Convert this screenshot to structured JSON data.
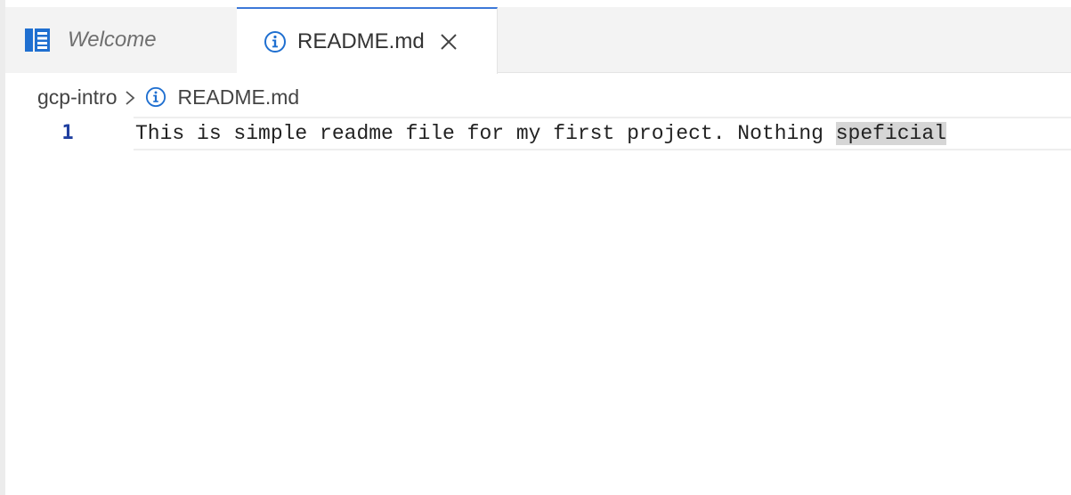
{
  "tabs": {
    "welcome": {
      "label": "Welcome",
      "icon": "welcome-icon"
    },
    "readme": {
      "label": "README.md",
      "icon": "info-icon",
      "close_icon": "close-icon"
    }
  },
  "breadcrumb": {
    "folder": "gcp-intro",
    "separator_icon": "chevron-right-icon",
    "file_icon": "info-icon",
    "file": "README.md"
  },
  "editor": {
    "lines": [
      {
        "number": "1",
        "text_before": "This is simple readme file for my first project. Nothing ",
        "highlighted_text": "speficial"
      }
    ]
  },
  "colors": {
    "accent": "#3c78d8",
    "tab_inactive_bg": "#f3f3f3",
    "line_number": "#1f3fa0",
    "word_highlight": "#d6d6d6"
  }
}
